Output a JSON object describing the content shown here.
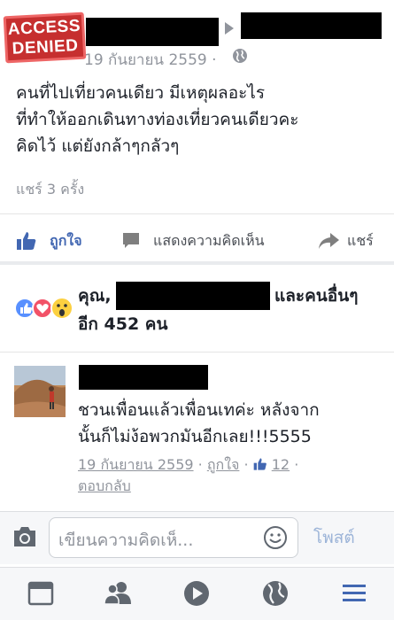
{
  "post": {
    "stamp_line1": "ACCESS",
    "stamp_line2": "DENIED",
    "date": "19 กันยายน 2559 · ",
    "text_lines": [
      "คนที่ไปเที่ยวคนเดียว มีเหตุผลอะไร",
      "ที่ทำให้ออกเดินทางท่องเที่ยวคนเดียวคะ",
      "คิดไว้ แต่ยังกล้าๆกลัวๆ"
    ],
    "share_count": "แชร์ 3 ครั้ง"
  },
  "actions": {
    "like": "ถูกใจ",
    "comment": "แสดงความคิดเห็น",
    "share": "แชร์"
  },
  "reactions": {
    "prefix": "คุณ,",
    "suffix": "และคนอื่นๆ",
    "count_line": "อีก 452 คน"
  },
  "comment": {
    "text_lines": [
      "ชวนเพื่อนแล้วเพื่อนเทค่ะ หลังจาก",
      "นั้นก็ไม่ง้อพวกมันอีกเลย!!!5555"
    ],
    "date": "19 กันยายน 2559",
    "like_label": "ถูกใจ",
    "like_count": "12",
    "reply": "ตอบกลับ"
  },
  "composer": {
    "placeholder": "เขียนความคิดเห็...",
    "post_button": "โพสต์"
  },
  "colors": {
    "accent": "#4267b2",
    "muted": "#90949c",
    "stamp": "#c62f2f"
  },
  "icons": [
    "globe-icon",
    "like-icon",
    "comment-icon",
    "share-icon",
    "camera-icon",
    "smiley-icon",
    "news-feed-icon",
    "friends-icon",
    "video-icon",
    "globe-notifications-icon",
    "menu-icon"
  ]
}
